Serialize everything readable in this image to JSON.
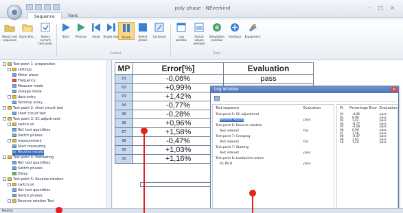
{
  "window": {
    "title": "poly phase - NEverkind",
    "controls": [
      "–",
      "□",
      "×"
    ]
  },
  "tabs": [
    {
      "label": "Sequence"
    },
    {
      "label": "Tools"
    }
  ],
  "ribbon": {
    "buttons": [
      {
        "label": "Select test sequence",
        "icon": "folder-select-icon"
      },
      {
        "label": "Open Wiz...",
        "icon": "folder-open-icon"
      },
      {
        "label": "Select current test point",
        "icon": "target-icon"
      },
      {
        "label": "Start",
        "icon": "play-icon"
      },
      {
        "label": "Process",
        "icon": "play-icon"
      },
      {
        "label": "Initial",
        "icon": "skip-back-icon"
      },
      {
        "label": "Single step",
        "icon": "step-icon"
      },
      {
        "label": "Break",
        "icon": "pause-icon"
      },
      {
        "label": "Select phase",
        "icon": "stop-icon"
      },
      {
        "label": "Continue",
        "icon": "continue-icon"
      },
      {
        "label": "Log window",
        "icon": "log-window-icon"
      },
      {
        "label": "Actual values window",
        "icon": "values-window-icon"
      },
      {
        "label": "Simulation window",
        "icon": "simulation-icon"
      },
      {
        "label": "Interface",
        "icon": "interface-icon"
      },
      {
        "label": "Equipment",
        "icon": "equipment-icon"
      }
    ],
    "groups": [
      {
        "label": "Control"
      },
      {
        "label": "Tools"
      }
    ]
  },
  "tree": {
    "items": [
      {
        "label": "Test point 1: preparation",
        "kind": "folder"
      },
      {
        "label": "settings",
        "kind": "folder"
      },
      {
        "label": "Meter place",
        "kind": "blue"
      },
      {
        "label": "Frequency",
        "kind": "red"
      },
      {
        "label": "Measure mode",
        "kind": "blue"
      },
      {
        "label": "Dosage mode",
        "kind": "blue"
      },
      {
        "label": "data entry",
        "kind": "folder"
      },
      {
        "label": "Terminal entry",
        "kind": "blue"
      },
      {
        "label": "Test point 2: short circuit test",
        "kind": "folder"
      },
      {
        "label": "short circuit test",
        "kind": "blue"
      },
      {
        "label": "Test point 3: SC adjustment",
        "kind": "folder"
      },
      {
        "label": "switch on",
        "kind": "folder"
      },
      {
        "label": "Ref. test quantities",
        "kind": "blue"
      },
      {
        "label": "Switch phases",
        "kind": "blue"
      },
      {
        "label": "measurement",
        "kind": "folder"
      },
      {
        "label": "Start measuring",
        "kind": "blue"
      },
      {
        "label": "Receive results",
        "kind": "blue"
      },
      {
        "label": "Test point 4: Preheating",
        "kind": "folder"
      },
      {
        "label": "Ref. test quantities",
        "kind": "blue"
      },
      {
        "label": "Switch phases",
        "kind": "blue"
      },
      {
        "label": "Delay",
        "kind": "green"
      },
      {
        "label": "Test point 5: Reverse rotation",
        "kind": "folder"
      },
      {
        "label": "switch on",
        "kind": "folder"
      },
      {
        "label": "Ref. test quantities",
        "kind": "blue"
      },
      {
        "label": "Switch phases",
        "kind": "blue"
      },
      {
        "label": "Reverse rotation Test",
        "kind": "folder"
      }
    ]
  },
  "table": {
    "headers": {
      "mp": "MP",
      "error": "Error[%]",
      "evaluation": "Evaluation"
    },
    "rows": [
      {
        "mp": "01",
        "error": "-0,06%",
        "evaluation": "pass"
      },
      {
        "mp": "02",
        "error": "+0,99%",
        "evaluation": "pass"
      },
      {
        "mp": "03",
        "error": "+1,42%",
        "evaluation": "pass"
      },
      {
        "mp": "04",
        "error": "-0,77%",
        "evaluation": "pass"
      },
      {
        "mp": "05",
        "error": "-0,28%",
        "evaluation": "pass"
      },
      {
        "mp": "06",
        "error": "+0,96%",
        "evaluation": "pass"
      },
      {
        "mp": "07",
        "error": "+1,58%",
        "evaluation": "pass"
      },
      {
        "mp": "08",
        "error": "-0,47%",
        "evaluation": "pass"
      },
      {
        "mp": "09",
        "error": "+1,03%",
        "evaluation": "pass"
      },
      {
        "mp": "10",
        "error": "+1,16%",
        "evaluation": "pass"
      }
    ]
  },
  "log_window": {
    "title": "Log window",
    "close": "×",
    "left_headers": {
      "sequence": "Test sequence",
      "evaluation": "Evaluation"
    },
    "left_rows": [
      {
        "label": "Test point 5: SC adjustment",
        "value": ""
      },
      {
        "label": "Receive results",
        "value": "pass",
        "selected": true
      },
      {
        "label": "Test point 6: Reverse rotation",
        "value": ""
      },
      {
        "label": "Test interest",
        "value": "fail"
      },
      {
        "label": "Test point 7: Creeping",
        "value": ""
      },
      {
        "label": "Test interest",
        "value": "fail"
      },
      {
        "label": "Test point 7: Starting",
        "value": ""
      },
      {
        "label": "Test interest",
        "value": "pass"
      },
      {
        "label": "Test point 8: Loadpoints active",
        "value": ""
      },
      {
        "label": "SC RV B",
        "value": "pass"
      }
    ],
    "right_headers": {
      "m": "M.",
      "percentage": "Percentage Error",
      "evaluation": "Evaluation"
    },
    "right_rows": [
      {
        "m": "01",
        "pct": "-0,06",
        "eval": "pass"
      },
      {
        "m": "02",
        "pct": "0,99",
        "eval": "pass"
      },
      {
        "m": "03",
        "pct": "1,42",
        "eval": "pass"
      },
      {
        "m": "04",
        "pct": "-0,77",
        "eval": "pass"
      },
      {
        "m": "05",
        "pct": "-0,28",
        "eval": "pass"
      },
      {
        "m": "06",
        "pct": "0,96",
        "eval": "pass"
      },
      {
        "m": "07",
        "pct": "1,58",
        "eval": "pass"
      },
      {
        "m": "08",
        "pct": "-0,47",
        "eval": "pass"
      },
      {
        "m": "09",
        "pct": "1,03",
        "eval": "pass"
      },
      {
        "m": "10",
        "pct": "1,16",
        "eval": "pass"
      }
    ]
  },
  "status": {
    "text": "Ready"
  }
}
